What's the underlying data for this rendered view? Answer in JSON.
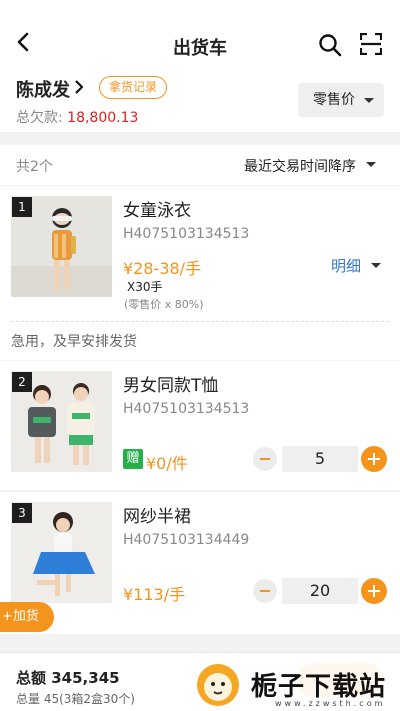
{
  "nav": {
    "title": "出货车"
  },
  "customer": {
    "name": "陈成发",
    "record_label": "拿货记录",
    "owe_label": "总欠款:",
    "owe_value": "18,800.13",
    "price_type": "零售价"
  },
  "list": {
    "count_label": "共2个",
    "sort_label": "最近交易时间降序"
  },
  "items": [
    {
      "index": "1",
      "name": "女童泳衣",
      "sku": "H4075103134513",
      "price": "¥28-38/手",
      "qty_line": "X30手",
      "note": "(零售价 x 80%)",
      "detail_label": "明细",
      "remark": "急用，及早安排发货"
    },
    {
      "index": "2",
      "name": "男女同款T恤",
      "sku": "H4075103134513",
      "gift_label": "赠",
      "price": "¥0/件",
      "quantity": "5"
    },
    {
      "index": "3",
      "name": "网纱半裙",
      "sku": "H4075103134449",
      "price": "¥113/手",
      "quantity": "20"
    }
  ],
  "add_goods_label": "+加货",
  "footer": {
    "total_label": "总额",
    "total_value": "345,345",
    "quantity_text": "总量 45(3箱2盒30个)"
  },
  "watermark": {
    "text": "栀子下载站",
    "sub": "www.zzwsth.com"
  },
  "colors": {
    "accent": "#f5941d",
    "debt": "#e02020",
    "link": "#3478c6",
    "gift": "#26b04b"
  }
}
